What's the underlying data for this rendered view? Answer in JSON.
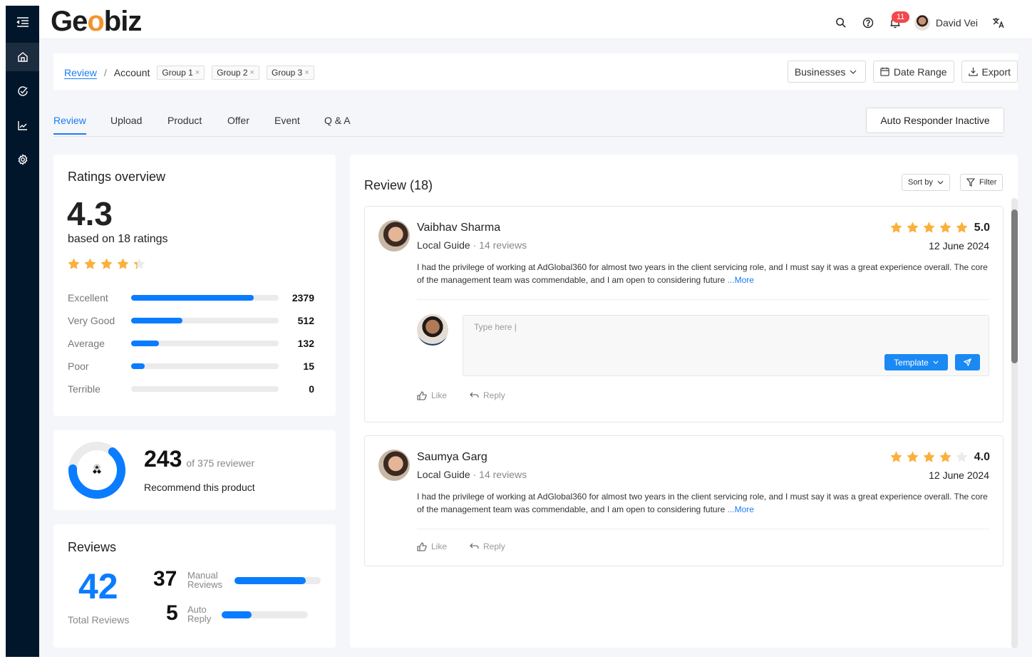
{
  "app": {
    "logo_text_1": "Ge",
    "logo_text_o": "o",
    "logo_text_2": "biz"
  },
  "sidebar": {
    "items": [
      {
        "name": "menu-collapse",
        "icon": "menu-collapse-icon"
      },
      {
        "name": "home",
        "icon": "home-icon",
        "active": true
      },
      {
        "name": "tasks",
        "icon": "check-circle-icon"
      },
      {
        "name": "analytics",
        "icon": "chart-line-icon"
      },
      {
        "name": "settings",
        "icon": "gear-icon"
      }
    ]
  },
  "topbar": {
    "notifications_count": "11",
    "user_name": "David Vei"
  },
  "breadcrumb": {
    "root": "Review",
    "separator": "/",
    "current": "Account",
    "chips": [
      {
        "label": "Group 1"
      },
      {
        "label": "Group 2"
      },
      {
        "label": "Group 3"
      }
    ],
    "close_glyph": "×"
  },
  "filters": {
    "businesses": "Businesses",
    "date_range": "Date Range",
    "export": "Export"
  },
  "tabs": [
    {
      "label": "Review",
      "active": true
    },
    {
      "label": "Upload"
    },
    {
      "label": "Product"
    },
    {
      "label": "Offer"
    },
    {
      "label": "Event"
    },
    {
      "label": "Q & A"
    }
  ],
  "auto_responder": {
    "label": "Auto Responder Inactive"
  },
  "ratings_overview": {
    "title": "Ratings overview",
    "score": "4.3",
    "score_value": 4.3,
    "subtitle": "based on 18 ratings",
    "breakdown": [
      {
        "label": "Excellent",
        "count": "2379",
        "fraction": 0.83
      },
      {
        "label": "Very Good",
        "count": "512",
        "fraction": 0.35
      },
      {
        "label": "Average",
        "count": "132",
        "fraction": 0.19
      },
      {
        "label": "Poor",
        "count": "15",
        "fraction": 0.09
      },
      {
        "label": "Terrible",
        "count": "0",
        "fraction": 0
      }
    ]
  },
  "recommend": {
    "count": "243",
    "of_text": "of 375 reviewer",
    "label": "Recommend this product",
    "fraction": 0.648
  },
  "reviews_summary": {
    "title": "Reviews",
    "total": "42",
    "total_label": "Total Reviews",
    "manual_count": "37",
    "manual_label_1": "Manual",
    "manual_label_2": "Reviews",
    "manual_fraction": 0.83,
    "auto_count": "5",
    "auto_label_1": "Auto",
    "auto_label_2": "Reply",
    "auto_fraction": 0.35
  },
  "review_list": {
    "title": "Review (18)",
    "sort_label": "Sort by",
    "filter_label": "Filter",
    "reviews": [
      {
        "name": "Vaibhav Sharma",
        "guide": "Local Guide",
        "reviews_count": " · 14 reviews",
        "rating": "5.0",
        "stars": 5,
        "date": "12 June 2024",
        "text": "I had the privilege of working at AdGlobal360 for almost two years in the client servicing role, and I must say it was a great experience overall. The core of the management team was commendable, and I am open to considering future ",
        "more": "...More",
        "reply_placeholder": "Type here |",
        "template_label": "Template",
        "like": "Like",
        "reply": "Reply"
      },
      {
        "name": "Saumya Garg",
        "guide": "Local Guide",
        "reviews_count": " · 14 reviews",
        "rating": "4.0",
        "stars": 4,
        "date": "12 June 2024",
        "text": "I had the privilege of working at AdGlobal360 for almost two years in the client servicing role, and I must say it was a great experience overall. The core of the management team was commendable, and I am open to considering future ",
        "more": "...More",
        "like": "Like",
        "reply": "Reply"
      }
    ]
  },
  "colors": {
    "accent": "#1a7cf5",
    "star": "#fbb03b",
    "star_empty": "#ebebeb",
    "sidebar": "#01162b",
    "bar": "#0a7cff"
  }
}
